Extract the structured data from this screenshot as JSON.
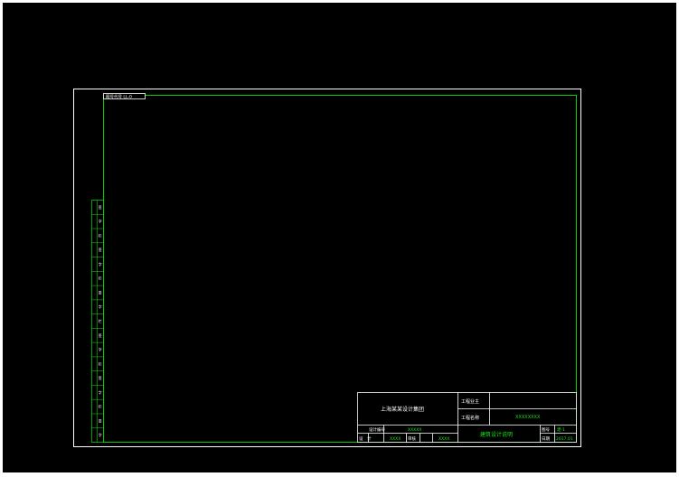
{
  "colors": {
    "background": "#000000",
    "sheet_border": "#ffffff",
    "frame_line": "#00cc00",
    "text_white": "#ffffff",
    "text_green": "#19e619"
  },
  "top_label": {
    "text": "图号代号 LL-0"
  },
  "title_block": {
    "company": "上海某某设计集团",
    "project_owner_label": "工程业主",
    "project_owner_value": "",
    "project_name_label": "工程名称",
    "project_name_value": "XXXXXXXX",
    "design_no_label": "设计编号",
    "design_no_value": "XXXXX",
    "design_label": "设　计",
    "design_value": "XXXX",
    "review_label": "审核",
    "review_value": "XXXX",
    "drawing_title": "建筑设计说明",
    "sheet_no_label": "图号",
    "sheet_no_value": "建-1",
    "date_label": "日期",
    "date_value": "2017.01"
  },
  "side_strip": {
    "cells": [
      "签",
      "字",
      "栏",
      "签",
      "字",
      "栏",
      "签",
      "字",
      "栏",
      "签",
      "字",
      "栏",
      "签",
      "字",
      "栏",
      "签",
      "字"
    ]
  }
}
